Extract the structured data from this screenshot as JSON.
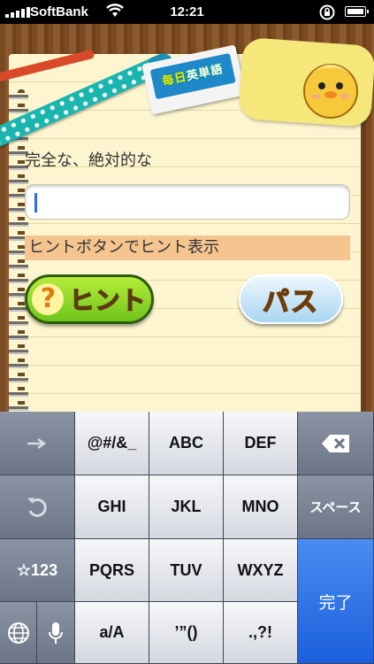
{
  "status": {
    "carrier": "SoftBank",
    "time": "12:21"
  },
  "quiz": {
    "question": "完全な、絶対的な",
    "answer_value": "",
    "hint_text": "ヒントボタンでヒント表示",
    "hint_button_label": "ヒント",
    "hint_button_mark": "?",
    "pass_button_label": "パス"
  },
  "keyboard": {
    "row1": [
      "→",
      "@#/&_",
      "ABC",
      "DEF"
    ],
    "row2": [
      "GHI",
      "JKL",
      "MNO",
      "スペース"
    ],
    "row3": [
      "☆123",
      "PQRS",
      "TUV",
      "WXYZ"
    ],
    "row4": [
      "a/A",
      "’”()",
      ".,?!"
    ],
    "done": "完了"
  }
}
